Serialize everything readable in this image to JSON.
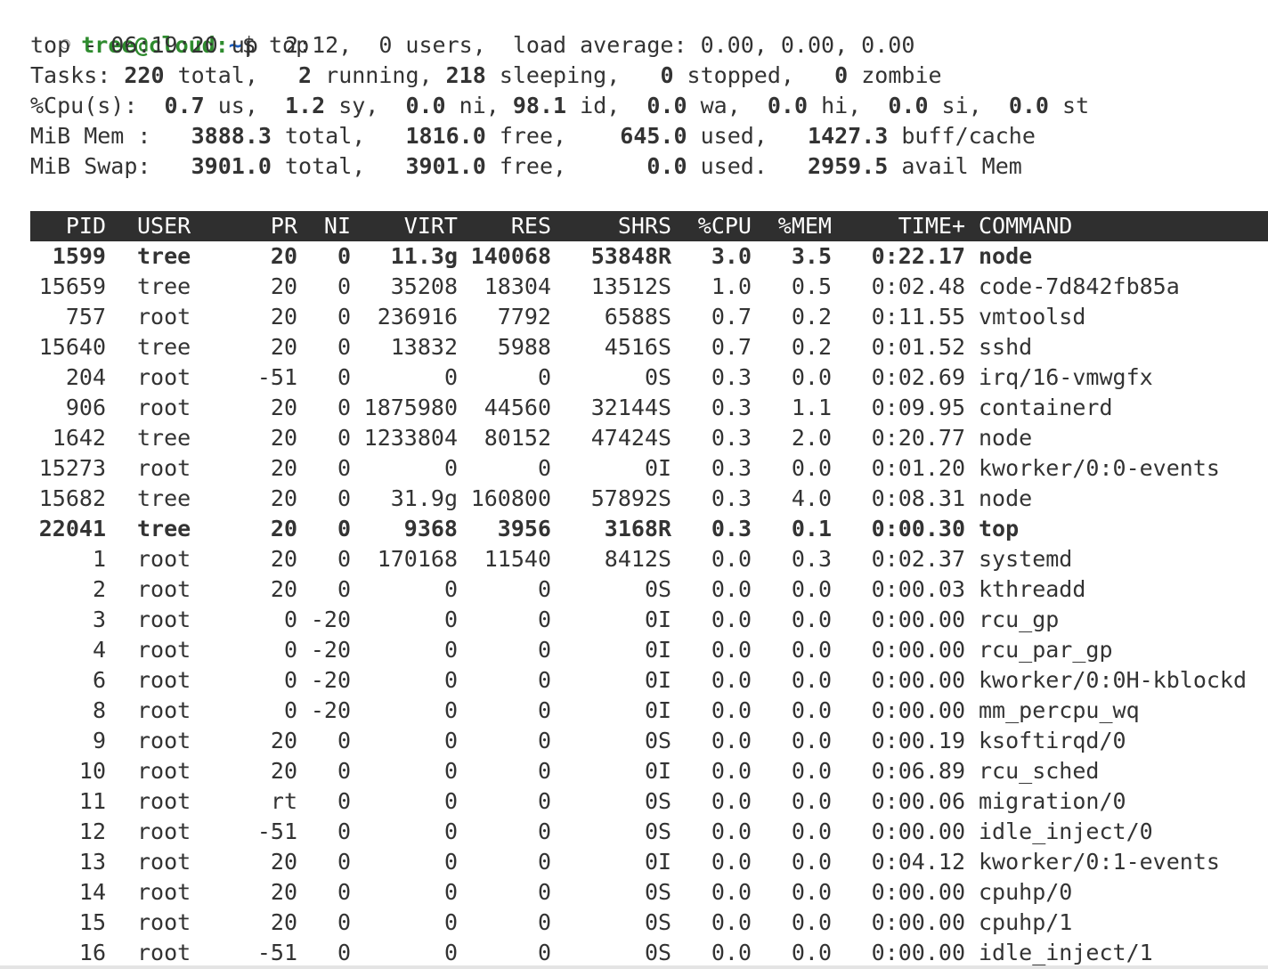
{
  "prompt": {
    "user_host": "tree@cloud",
    "sep": ":",
    "path": "~",
    "dollar": "$",
    "command": "top"
  },
  "summary": {
    "uptime": "top - 06:19:20 up  2:12,  0 users,  load average: 0.00, 0.00, 0.00",
    "tasks": [
      {
        "t": "Tasks: "
      },
      {
        "b": "220"
      },
      {
        "t": " total,   "
      },
      {
        "b": "2"
      },
      {
        "t": " running, "
      },
      {
        "b": "218"
      },
      {
        "t": " sleeping,   "
      },
      {
        "b": "0"
      },
      {
        "t": " stopped,   "
      },
      {
        "b": "0"
      },
      {
        "t": " zombie"
      }
    ],
    "cpu": [
      {
        "t": "%Cpu(s):  "
      },
      {
        "b": "0.7"
      },
      {
        "t": " us,  "
      },
      {
        "b": "1.2"
      },
      {
        "t": " sy,  "
      },
      {
        "b": "0.0"
      },
      {
        "t": " ni, "
      },
      {
        "b": "98.1"
      },
      {
        "t": " id,  "
      },
      {
        "b": "0.0"
      },
      {
        "t": " wa,  "
      },
      {
        "b": "0.0"
      },
      {
        "t": " hi,  "
      },
      {
        "b": "0.0"
      },
      {
        "t": " si,  "
      },
      {
        "b": "0.0"
      },
      {
        "t": " st"
      }
    ],
    "mem": [
      {
        "t": "MiB Mem :   "
      },
      {
        "b": "3888.3"
      },
      {
        "t": " total,   "
      },
      {
        "b": "1816.0"
      },
      {
        "t": " free,    "
      },
      {
        "b": "645.0"
      },
      {
        "t": " used,   "
      },
      {
        "b": "1427.3"
      },
      {
        "t": " buff/cache"
      }
    ],
    "swap": [
      {
        "t": "MiB Swap:   "
      },
      {
        "b": "3901.0"
      },
      {
        "t": " total,   "
      },
      {
        "b": "3901.0"
      },
      {
        "t": " free,      "
      },
      {
        "b": "0.0"
      },
      {
        "t": " used.   "
      },
      {
        "b": "2959.5"
      },
      {
        "t": " avail Mem"
      }
    ]
  },
  "columns": [
    "PID",
    "USER",
    "PR",
    "NI",
    "VIRT",
    "RES",
    "SHR",
    "S",
    "%CPU",
    "%MEM",
    "TIME+",
    "COMMAND"
  ],
  "processes": [
    {
      "pid": "1599",
      "user": "tree",
      "pr": "20",
      "ni": "0",
      "virt": "11.3g",
      "res": "140068",
      "shr": "53848",
      "s": "R",
      "cpu": "3.0",
      "mem": "3.5",
      "time": "0:22.17",
      "cmd": "node",
      "bold": true
    },
    {
      "pid": "15659",
      "user": "tree",
      "pr": "20",
      "ni": "0",
      "virt": "35208",
      "res": "18304",
      "shr": "13512",
      "s": "S",
      "cpu": "1.0",
      "mem": "0.5",
      "time": "0:02.48",
      "cmd": "code-7d842fb85a"
    },
    {
      "pid": "757",
      "user": "root",
      "pr": "20",
      "ni": "0",
      "virt": "236916",
      "res": "7792",
      "shr": "6588",
      "s": "S",
      "cpu": "0.7",
      "mem": "0.2",
      "time": "0:11.55",
      "cmd": "vmtoolsd"
    },
    {
      "pid": "15640",
      "user": "tree",
      "pr": "20",
      "ni": "0",
      "virt": "13832",
      "res": "5988",
      "shr": "4516",
      "s": "S",
      "cpu": "0.7",
      "mem": "0.2",
      "time": "0:01.52",
      "cmd": "sshd"
    },
    {
      "pid": "204",
      "user": "root",
      "pr": "-51",
      "ni": "0",
      "virt": "0",
      "res": "0",
      "shr": "0",
      "s": "S",
      "cpu": "0.3",
      "mem": "0.0",
      "time": "0:02.69",
      "cmd": "irq/16-vmwgfx"
    },
    {
      "pid": "906",
      "user": "root",
      "pr": "20",
      "ni": "0",
      "virt": "1875980",
      "res": "44560",
      "shr": "32144",
      "s": "S",
      "cpu": "0.3",
      "mem": "1.1",
      "time": "0:09.95",
      "cmd": "containerd"
    },
    {
      "pid": "1642",
      "user": "tree",
      "pr": "20",
      "ni": "0",
      "virt": "1233804",
      "res": "80152",
      "shr": "47424",
      "s": "S",
      "cpu": "0.3",
      "mem": "2.0",
      "time": "0:20.77",
      "cmd": "node"
    },
    {
      "pid": "15273",
      "user": "root",
      "pr": "20",
      "ni": "0",
      "virt": "0",
      "res": "0",
      "shr": "0",
      "s": "I",
      "cpu": "0.3",
      "mem": "0.0",
      "time": "0:01.20",
      "cmd": "kworker/0:0-events"
    },
    {
      "pid": "15682",
      "user": "tree",
      "pr": "20",
      "ni": "0",
      "virt": "31.9g",
      "res": "160800",
      "shr": "57892",
      "s": "S",
      "cpu": "0.3",
      "mem": "4.0",
      "time": "0:08.31",
      "cmd": "node"
    },
    {
      "pid": "22041",
      "user": "tree",
      "pr": "20",
      "ni": "0",
      "virt": "9368",
      "res": "3956",
      "shr": "3168",
      "s": "R",
      "cpu": "0.3",
      "mem": "0.1",
      "time": "0:00.30",
      "cmd": "top",
      "bold": true
    },
    {
      "pid": "1",
      "user": "root",
      "pr": "20",
      "ni": "0",
      "virt": "170168",
      "res": "11540",
      "shr": "8412",
      "s": "S",
      "cpu": "0.0",
      "mem": "0.3",
      "time": "0:02.37",
      "cmd": "systemd"
    },
    {
      "pid": "2",
      "user": "root",
      "pr": "20",
      "ni": "0",
      "virt": "0",
      "res": "0",
      "shr": "0",
      "s": "S",
      "cpu": "0.0",
      "mem": "0.0",
      "time": "0:00.03",
      "cmd": "kthreadd"
    },
    {
      "pid": "3",
      "user": "root",
      "pr": "0",
      "ni": "-20",
      "virt": "0",
      "res": "0",
      "shr": "0",
      "s": "I",
      "cpu": "0.0",
      "mem": "0.0",
      "time": "0:00.00",
      "cmd": "rcu_gp"
    },
    {
      "pid": "4",
      "user": "root",
      "pr": "0",
      "ni": "-20",
      "virt": "0",
      "res": "0",
      "shr": "0",
      "s": "I",
      "cpu": "0.0",
      "mem": "0.0",
      "time": "0:00.00",
      "cmd": "rcu_par_gp"
    },
    {
      "pid": "6",
      "user": "root",
      "pr": "0",
      "ni": "-20",
      "virt": "0",
      "res": "0",
      "shr": "0",
      "s": "I",
      "cpu": "0.0",
      "mem": "0.0",
      "time": "0:00.00",
      "cmd": "kworker/0:0H-kblockd"
    },
    {
      "pid": "8",
      "user": "root",
      "pr": "0",
      "ni": "-20",
      "virt": "0",
      "res": "0",
      "shr": "0",
      "s": "I",
      "cpu": "0.0",
      "mem": "0.0",
      "time": "0:00.00",
      "cmd": "mm_percpu_wq"
    },
    {
      "pid": "9",
      "user": "root",
      "pr": "20",
      "ni": "0",
      "virt": "0",
      "res": "0",
      "shr": "0",
      "s": "S",
      "cpu": "0.0",
      "mem": "0.0",
      "time": "0:00.19",
      "cmd": "ksoftirqd/0"
    },
    {
      "pid": "10",
      "user": "root",
      "pr": "20",
      "ni": "0",
      "virt": "0",
      "res": "0",
      "shr": "0",
      "s": "I",
      "cpu": "0.0",
      "mem": "0.0",
      "time": "0:06.89",
      "cmd": "rcu_sched"
    },
    {
      "pid": "11",
      "user": "root",
      "pr": "rt",
      "ni": "0",
      "virt": "0",
      "res": "0",
      "shr": "0",
      "s": "S",
      "cpu": "0.0",
      "mem": "0.0",
      "time": "0:00.06",
      "cmd": "migration/0"
    },
    {
      "pid": "12",
      "user": "root",
      "pr": "-51",
      "ni": "0",
      "virt": "0",
      "res": "0",
      "shr": "0",
      "s": "S",
      "cpu": "0.0",
      "mem": "0.0",
      "time": "0:00.00",
      "cmd": "idle_inject/0"
    },
    {
      "pid": "13",
      "user": "root",
      "pr": "20",
      "ni": "0",
      "virt": "0",
      "res": "0",
      "shr": "0",
      "s": "I",
      "cpu": "0.0",
      "mem": "0.0",
      "time": "0:04.12",
      "cmd": "kworker/0:1-events"
    },
    {
      "pid": "14",
      "user": "root",
      "pr": "20",
      "ni": "0",
      "virt": "0",
      "res": "0",
      "shr": "0",
      "s": "S",
      "cpu": "0.0",
      "mem": "0.0",
      "time": "0:00.00",
      "cmd": "cpuhp/0"
    },
    {
      "pid": "15",
      "user": "root",
      "pr": "20",
      "ni": "0",
      "virt": "0",
      "res": "0",
      "shr": "0",
      "s": "S",
      "cpu": "0.0",
      "mem": "0.0",
      "time": "0:00.00",
      "cmd": "cpuhp/1"
    },
    {
      "pid": "16",
      "user": "root",
      "pr": "-51",
      "ni": "0",
      "virt": "0",
      "res": "0",
      "shr": "0",
      "s": "S",
      "cpu": "0.0",
      "mem": "0.0",
      "time": "0:00.00",
      "cmd": "idle_inject/1"
    }
  ],
  "colors": {
    "user_host": "#2e8b2e",
    "path": "#1f5fbf",
    "header_bg": "#2f2f2f",
    "text": "#333333"
  }
}
